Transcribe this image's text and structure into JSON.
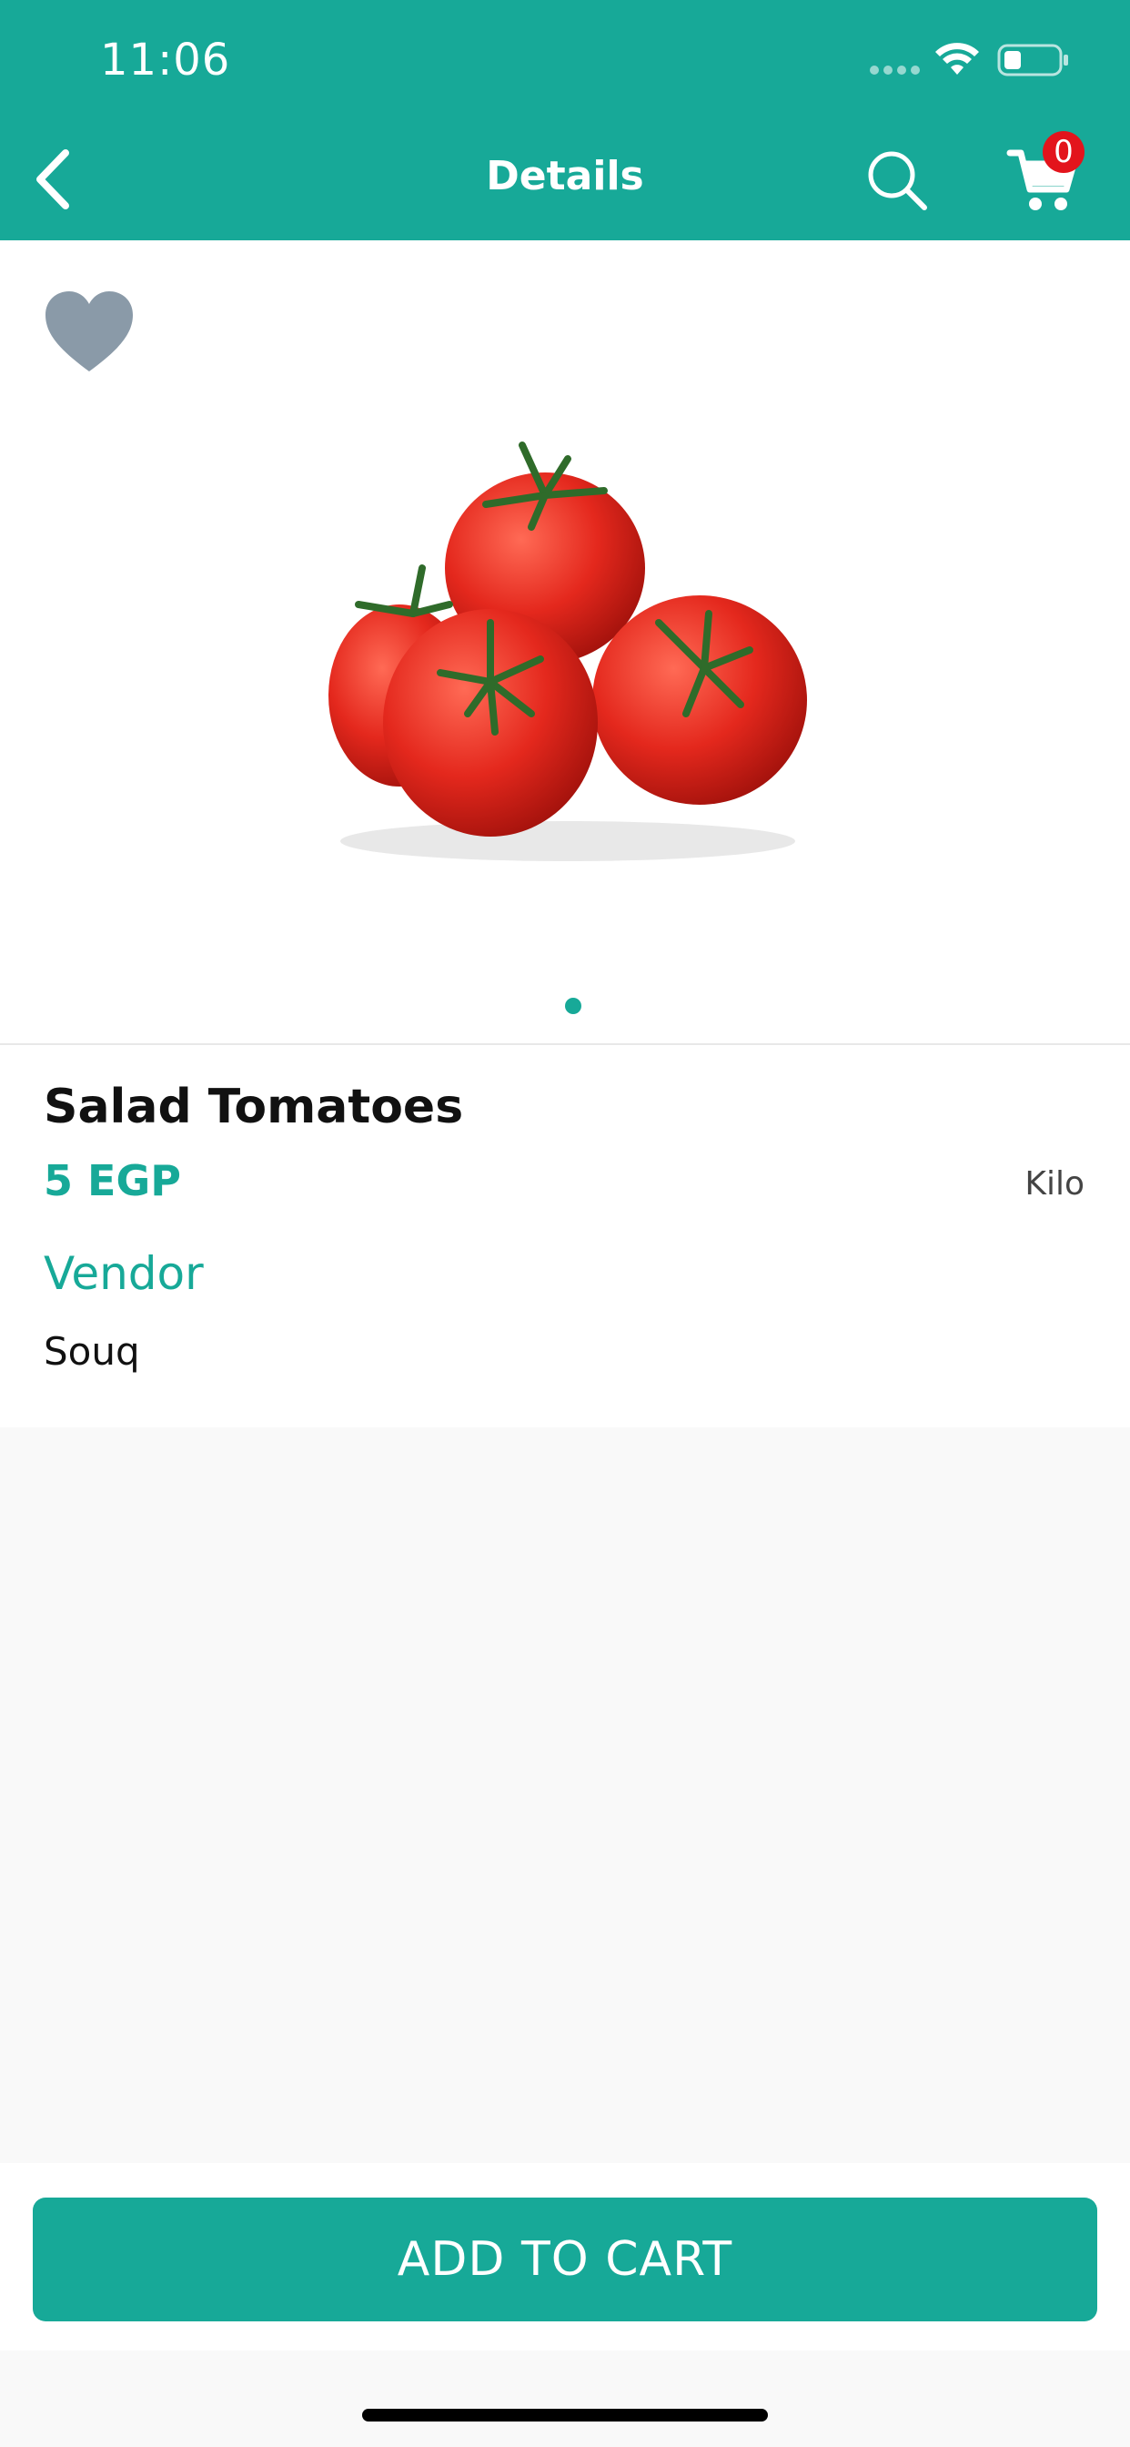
{
  "status_bar": {
    "time": "11:06"
  },
  "nav": {
    "title": "Details",
    "cart_count": "0"
  },
  "product": {
    "name": "Salad Tomatoes",
    "price": "5 EGP",
    "unit": "Kilo",
    "vendor_label": "Vendor",
    "vendor_name": "Souq"
  },
  "cta": {
    "label": "ADD TO CART"
  },
  "colors": {
    "accent": "#17a998",
    "badge": "#e3141c",
    "favorite": "#8a9aa8"
  },
  "icons": [
    "back-chevron-icon",
    "search-icon",
    "cart-icon",
    "heart-icon",
    "wifi-icon",
    "battery-icon",
    "signal-icon"
  ]
}
